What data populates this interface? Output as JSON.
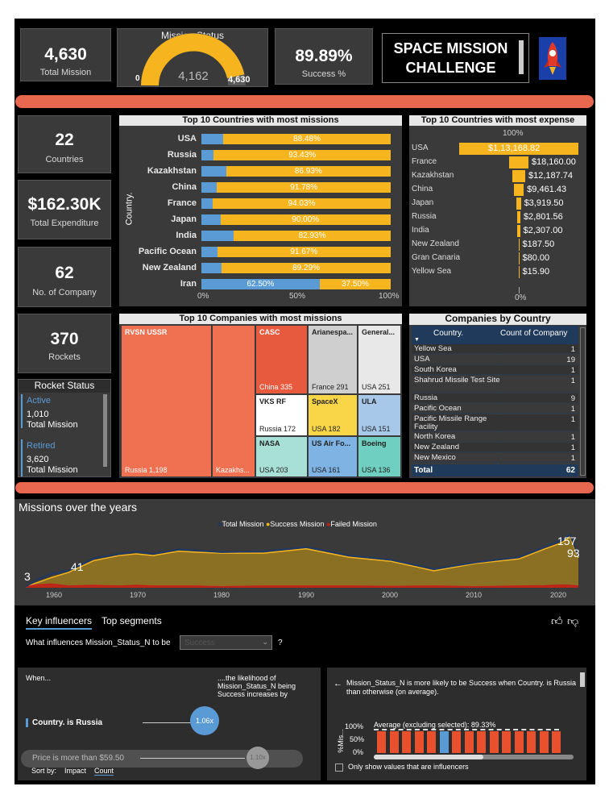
{
  "kpis": {
    "total_mission": {
      "value": "4,630",
      "label": "Total Mission"
    },
    "mission_status": {
      "title": "Mission Status",
      "min": "0",
      "value": "4,162",
      "max": "4,630",
      "fill_fraction": 0.899
    },
    "success": {
      "value": "89.89%",
      "label": "Success %"
    },
    "title": {
      "line1": "SPACE MISSION",
      "line2": "CHALLENGE"
    },
    "countries": {
      "value": "22",
      "label": "Countries"
    },
    "expenditure": {
      "value": "$162.30K",
      "label": "Total Expenditure"
    },
    "companies": {
      "value": "62",
      "label": "No. of Company"
    },
    "rockets": {
      "value": "370",
      "label": "Rockets"
    }
  },
  "rocket_status": {
    "title": "Rocket Status",
    "active_label": "Active",
    "active_value": "1,010",
    "active_sub": "Total Mission",
    "retired_label": "Retired",
    "retired_value": "3,620",
    "retired_sub": "Total Mission"
  },
  "top_countries": {
    "title": "Top 10 Countries with most missions",
    "axis_label": "Country.",
    "ticks": [
      "0%",
      "50%",
      "100%"
    ],
    "rows": [
      {
        "name": "USA",
        "success": 88.48,
        "label": "88.48%"
      },
      {
        "name": "Russia",
        "success": 93.43,
        "label": "93.43%"
      },
      {
        "name": "Kazakhstan",
        "success": 86.93,
        "label": "86.93%"
      },
      {
        "name": "China",
        "success": 91.78,
        "label": "91.78%"
      },
      {
        "name": "France",
        "success": 94.03,
        "label": "94.03%"
      },
      {
        "name": "Japan",
        "success": 90.0,
        "label": "90.00%"
      },
      {
        "name": "India",
        "success": 82.93,
        "label": "82.93%"
      },
      {
        "name": "Pacific Ocean",
        "success": 91.67,
        "label": "91.67%"
      },
      {
        "name": "New Zealand",
        "success": 89.29,
        "label": "89.29%"
      },
      {
        "name": "Iran",
        "success": 37.5,
        "label": "37.50%",
        "blue_label": "62.50%"
      }
    ]
  },
  "top_expense": {
    "title": "Top 10 Countries with most expense",
    "top_label": "100%",
    "bottom_label": "0%",
    "rows": [
      {
        "name": "USA",
        "value": 113168.82,
        "label": "$1,13,168.82"
      },
      {
        "name": "France",
        "value": 18160.0,
        "label": "$18,160.00"
      },
      {
        "name": "Kazakhstan",
        "value": 12187.74,
        "label": "$12,187.74"
      },
      {
        "name": "China",
        "value": 9461.43,
        "label": "$9,461.43"
      },
      {
        "name": "Japan",
        "value": 3919.5,
        "label": "$3,919.50"
      },
      {
        "name": "Russia",
        "value": 2801.56,
        "label": "$2,801.56"
      },
      {
        "name": "India",
        "value": 2307.0,
        "label": "$2,307.00"
      },
      {
        "name": "New Zealand",
        "value": 187.5,
        "label": "$187.50"
      },
      {
        "name": "Gran Canaria",
        "value": 80.0,
        "label": "$80.00"
      },
      {
        "name": "Yellow Sea",
        "value": 15.9,
        "label": "$15.90"
      }
    ]
  },
  "top_companies": {
    "title": "Top 10 Companies with most missions",
    "cells": [
      {
        "name": "RVSN USSR",
        "value": "Russia 1,198"
      },
      {
        "name": "",
        "value": "Kazakhs..."
      },
      {
        "name": "CASC",
        "value": "China 335"
      },
      {
        "name": "Arianespa...",
        "value": "France 291"
      },
      {
        "name": "General...",
        "value": "USA 251"
      },
      {
        "name": "VKS RF",
        "value": "Russia 172"
      },
      {
        "name": "SpaceX",
        "value": "USA 182"
      },
      {
        "name": "ULA",
        "value": "USA 151"
      },
      {
        "name": "NASA",
        "value": "USA 203"
      },
      {
        "name": "US Air Fo...",
        "value": "USA 161"
      },
      {
        "name": "Boeing",
        "value": "USA 136"
      }
    ]
  },
  "companies_by_country": {
    "title": "Companies by Country",
    "col1": "Country.",
    "col2": "Count of Company",
    "rows": [
      {
        "country": "Yellow Sea",
        "count": "1"
      },
      {
        "country": "USA",
        "count": "19"
      },
      {
        "country": "South Korea",
        "count": "1"
      },
      {
        "country": "Shahrud Missile Test Site",
        "count": "1"
      },
      {
        "country": "Russia",
        "count": "9"
      },
      {
        "country": "Pacific Ocean",
        "count": "1"
      },
      {
        "country": "Pacific Missile Range Facility",
        "count": "1"
      },
      {
        "country": "North Korea",
        "count": "1"
      },
      {
        "country": "New Zealand",
        "count": "1"
      },
      {
        "country": "New Mexico",
        "count": "1"
      }
    ],
    "total_label": "Total",
    "total_value": "62"
  },
  "missions_over_years": {
    "title": "Missions over the years",
    "legend": [
      {
        "name": "Total Mission",
        "color": "#1f3864"
      },
      {
        "name": "Success Mission",
        "color": "#f6b51e"
      },
      {
        "name": "Failed Mission",
        "color": "#c0201a"
      }
    ],
    "x_ticks": [
      "1960",
      "1970",
      "1980",
      "1990",
      "2000",
      "2010",
      "2020"
    ],
    "annotations": [
      "3",
      "41",
      "157",
      "93"
    ]
  },
  "chart_data": {
    "type": "area",
    "title": "Missions over the years",
    "x": [
      1957,
      1958,
      1960,
      1962,
      1965,
      1968,
      1970,
      1972,
      1975,
      1977,
      1980,
      1985,
      1990,
      1995,
      2000,
      2005,
      2010,
      2015,
      2018,
      2020,
      2021,
      2022
    ],
    "series": [
      {
        "name": "Total Mission",
        "values": [
          3,
          20,
          41,
          50,
          87,
          100,
          107,
          100,
          113,
          110,
          105,
          107,
          120,
          95,
          82,
          55,
          75,
          90,
          120,
          140,
          157,
          93
        ]
      },
      {
        "name": "Success Mission",
        "values": [
          1,
          12,
          30,
          45,
          80,
          95,
          100,
          95,
          108,
          105,
          102,
          102,
          115,
          90,
          78,
          50,
          72,
          85,
          114,
          132,
          150,
          88
        ]
      },
      {
        "name": "Failed Mission",
        "values": [
          2,
          8,
          11,
          5,
          7,
          5,
          7,
          5,
          5,
          5,
          3,
          5,
          5,
          5,
          4,
          5,
          3,
          5,
          6,
          8,
          7,
          5
        ]
      }
    ],
    "xlim": [
      1957,
      2022
    ],
    "xlabel": "",
    "ylabel": ""
  },
  "influencers": {
    "tab_key": "Key influencers",
    "tab_top": "Top segments",
    "question_prefix": "What influences Mission_Status_N to be",
    "dropdown_value": "Success",
    "question_suffix": "?",
    "when": "When...",
    "likelihood": "....the likelihood of Mission_Status_N being Success increases by",
    "inf1_label": "Country. is Russia",
    "inf1_value": "1.06x",
    "inf2_label": "Price is more than $59.50",
    "inf2_value": "1.10x",
    "sort_by": "Sort by:",
    "sort_impact": "Impact",
    "sort_count": "Count",
    "detail_text": "Mission_Status_N is more likely to be Success when Country. is Russia than otherwise (on average).",
    "avg_text": "Average (excluding selected): 89.33%",
    "y_ticks": [
      "100%",
      "50%",
      "0%"
    ],
    "y_label": "%Mis...",
    "checkbox_label": "Only show values that are influencers",
    "bars": [
      0.9,
      0.9,
      0.9,
      0.9,
      0.9,
      0.9,
      0.9,
      0.9,
      0.9,
      0.9,
      0.9,
      0.9,
      0.9,
      0.9,
      0.9
    ],
    "selected_index": 5
  }
}
